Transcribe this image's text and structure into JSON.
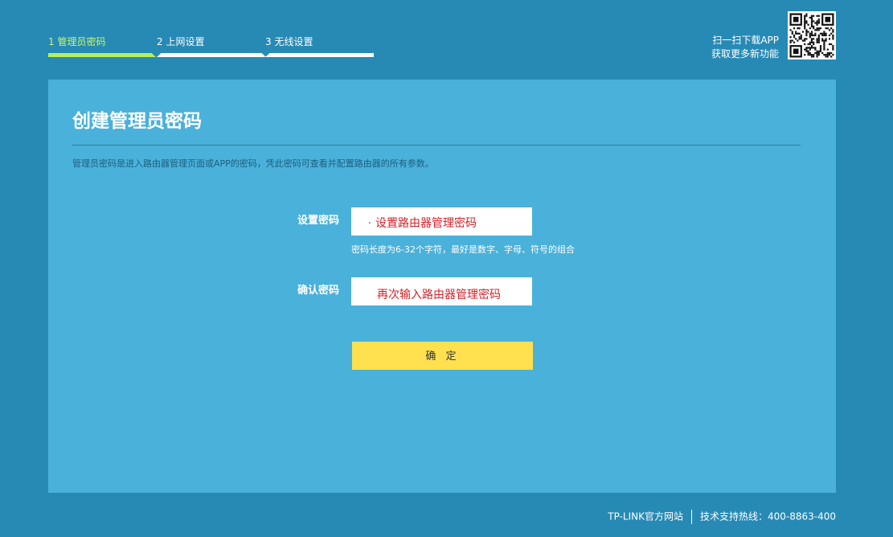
{
  "steps": [
    {
      "label": "1 管理员密码",
      "active": true
    },
    {
      "label": "2 上网设置",
      "active": false
    },
    {
      "label": "3 无线设置",
      "active": false
    }
  ],
  "app": {
    "line1": "扫一扫下载APP",
    "line2": "获取更多新功能",
    "qr_icon": "qr-code-icon"
  },
  "panel": {
    "title": "创建管理员密码",
    "description": "管理员密码是进入路由器管理页面或APP的密码，凭此密码可查看并配置路由器的所有参数。"
  },
  "form": {
    "password_label": "设置密码",
    "password_placeholder": "设置路由器管理密码",
    "password_hint": "密码长度为6-32个字符，最好是数字、字母、符号的组合",
    "confirm_label": "确认密码",
    "confirm_placeholder": "再次输入路由器管理密码",
    "submit_label": "确 定"
  },
  "footer": {
    "official_site": "TP-LINK官方网站",
    "hotline": "技术支持热线：400-8863-400"
  },
  "colors": {
    "page_bg": "#268ab5",
    "panel_bg": "#4ab1da",
    "active_step": "#b7f05a",
    "button_bg": "#ffe14f",
    "placeholder_text": "#d81f26"
  }
}
